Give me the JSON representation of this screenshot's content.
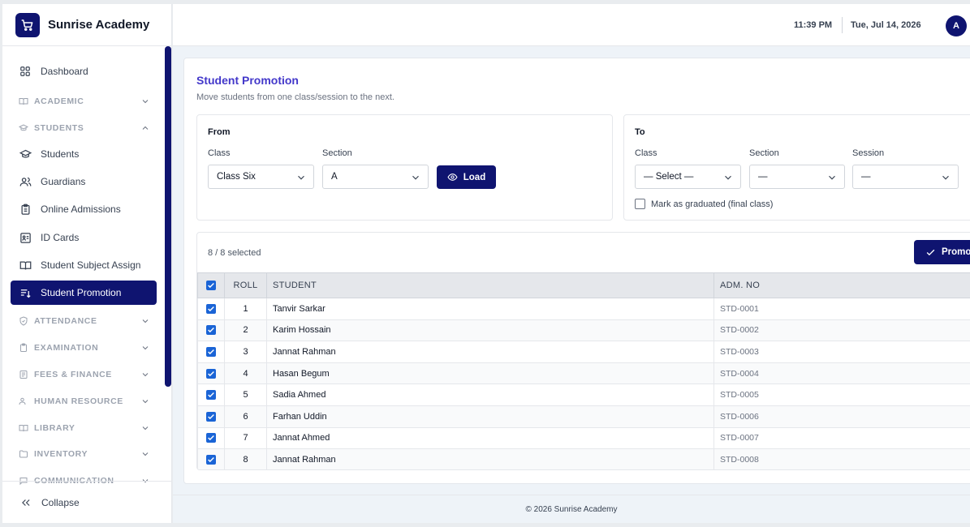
{
  "brand": {
    "name": "Sunrise Academy",
    "logo_icon": "cart-icon"
  },
  "header": {
    "time": "11:39 PM",
    "date": "Tue, Jul 14, 2026",
    "avatar_initial": "A"
  },
  "sidebar": {
    "dashboard": "Dashboard",
    "groups": {
      "academic": "ACADEMIC",
      "students": "STUDENTS",
      "attendance": "ATTENDANCE",
      "examination": "EXAMINATION",
      "fees": "FEES & FINANCE",
      "hr": "HUMAN RESOURCE",
      "library": "LIBRARY",
      "inventory": "INVENTORY",
      "communication": "COMMUNICATION"
    },
    "student_items": {
      "students": "Students",
      "guardians": "Guardians",
      "online_admissions": "Online Admissions",
      "id_cards": "ID Cards",
      "subject_assign": "Student Subject Assign",
      "promotion": "Student Promotion"
    },
    "collapse": "Collapse"
  },
  "page": {
    "title": "Student Promotion",
    "subtitle": "Move students from one class/session to the next."
  },
  "from": {
    "title": "From",
    "class_label": "Class",
    "class_value": "Class Six",
    "section_label": "Section",
    "section_value": "A",
    "load_button": "Load"
  },
  "to": {
    "title": "To",
    "class_label": "Class",
    "class_value": "— Select —",
    "section_label": "Section",
    "section_value": "—",
    "session_label": "Session",
    "session_value": "—",
    "graduated_label": "Mark as graduated (final class)"
  },
  "list": {
    "selected_count": "8 / 8 selected",
    "promote_button": "Promote",
    "columns": {
      "roll": "ROLL",
      "student": "STUDENT",
      "adm_no": "ADM. NO"
    },
    "rows": [
      {
        "roll": "1",
        "student": "Tanvir Sarkar",
        "adm_no": "STD-0001",
        "checked": true
      },
      {
        "roll": "2",
        "student": "Karim Hossain",
        "adm_no": "STD-0002",
        "checked": true
      },
      {
        "roll": "3",
        "student": "Jannat Rahman",
        "adm_no": "STD-0003",
        "checked": true
      },
      {
        "roll": "4",
        "student": "Hasan Begum",
        "adm_no": "STD-0004",
        "checked": true
      },
      {
        "roll": "5",
        "student": "Sadia Ahmed",
        "adm_no": "STD-0005",
        "checked": true
      },
      {
        "roll": "6",
        "student": "Farhan Uddin",
        "adm_no": "STD-0006",
        "checked": true
      },
      {
        "roll": "7",
        "student": "Jannat Ahmed",
        "adm_no": "STD-0007",
        "checked": true
      },
      {
        "roll": "8",
        "student": "Jannat Rahman",
        "adm_no": "STD-0008",
        "checked": true
      }
    ]
  },
  "footer": {
    "text": "© 2026 Sunrise Academy"
  },
  "colors": {
    "brand": "#0f1470",
    "title": "#4338ca",
    "checkbox": "#1a64d6"
  }
}
